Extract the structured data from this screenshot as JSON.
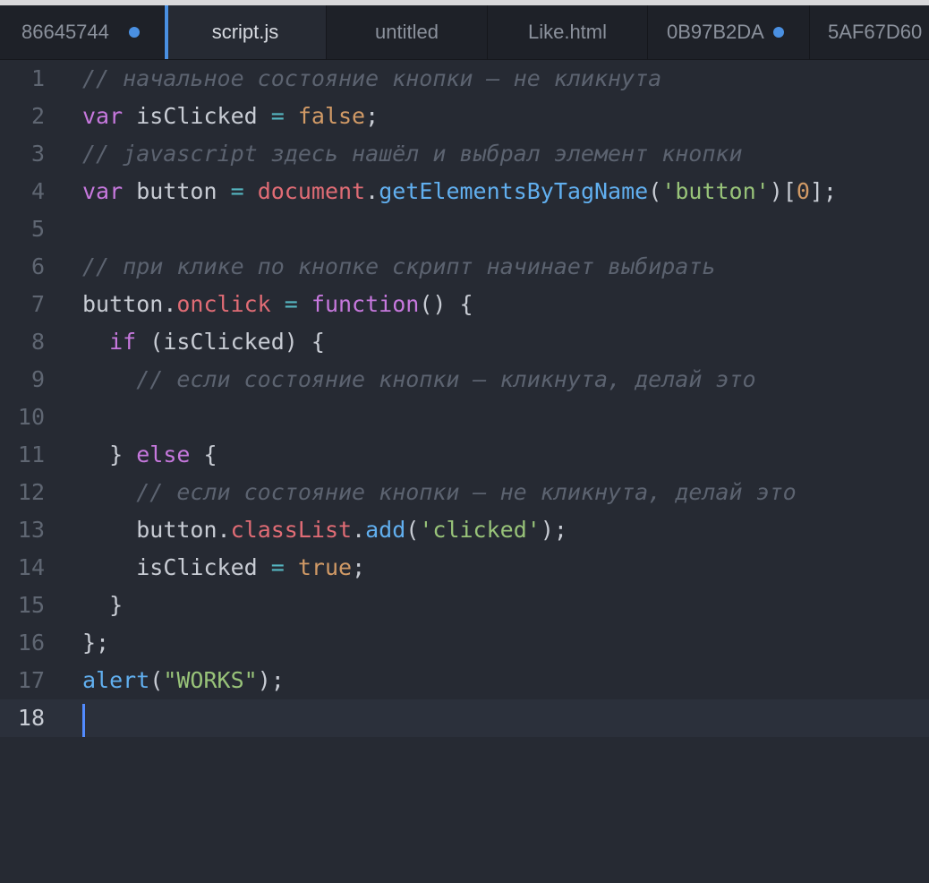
{
  "tabs": [
    {
      "label": "86645744",
      "modified": true
    },
    {
      "label": "script.js",
      "modified": false,
      "active": true
    },
    {
      "label": "untitled",
      "modified": false
    },
    {
      "label": "Like.html",
      "modified": false
    },
    {
      "label": "0B97B2DA",
      "modified": true
    },
    {
      "label": "5AF67D60",
      "modified": false
    }
  ],
  "editor": {
    "current_line": 18,
    "lines": [
      {
        "n": "1",
        "tokens": [
          [
            "cm",
            "// начальное состояние кнопки – не кликнута"
          ]
        ]
      },
      {
        "n": "2",
        "tokens": [
          [
            "kw",
            "var"
          ],
          [
            "vr",
            " isClicked "
          ],
          [
            "op",
            "="
          ],
          [
            "nb",
            " false"
          ],
          [
            "pu",
            ";"
          ]
        ]
      },
      {
        "n": "3",
        "tokens": [
          [
            "cm",
            "// javascript здесь нашёл и выбрал элемент кнопки"
          ]
        ]
      },
      {
        "n": "4",
        "tokens": [
          [
            "kw",
            "var"
          ],
          [
            "vr",
            " button "
          ],
          [
            "op",
            "="
          ],
          [
            "pu",
            " "
          ],
          [
            "pr",
            "document"
          ],
          [
            "pu",
            "."
          ],
          [
            "fn",
            "getElementsByTagName"
          ],
          [
            "pu",
            "("
          ],
          [
            "st",
            "'button'"
          ],
          [
            "pu",
            ")["
          ],
          [
            "nb",
            "0"
          ],
          [
            "pu",
            "];"
          ]
        ]
      },
      {
        "n": "5",
        "tokens": []
      },
      {
        "n": "6",
        "tokens": [
          [
            "cm",
            "// при клике по кнопке скрипт начинает выбирать"
          ]
        ]
      },
      {
        "n": "7",
        "tokens": [
          [
            "vr",
            "button"
          ],
          [
            "pu",
            "."
          ],
          [
            "pr",
            "onclick"
          ],
          [
            "op",
            " ="
          ],
          [
            "pu",
            " "
          ],
          [
            "kw",
            "function"
          ],
          [
            "pu",
            "() {"
          ]
        ]
      },
      {
        "n": "8",
        "tokens": [
          [
            "pu",
            "  "
          ],
          [
            "kw",
            "if"
          ],
          [
            "pu",
            " (isClicked) {"
          ]
        ]
      },
      {
        "n": "9",
        "tokens": [
          [
            "pu",
            "    "
          ],
          [
            "cm",
            "// если состояние кнопки – кликнута, делай это"
          ]
        ]
      },
      {
        "n": "10",
        "tokens": []
      },
      {
        "n": "11",
        "tokens": [
          [
            "pu",
            "  } "
          ],
          [
            "kw",
            "else"
          ],
          [
            "pu",
            " {"
          ]
        ]
      },
      {
        "n": "12",
        "tokens": [
          [
            "pu",
            "    "
          ],
          [
            "cm",
            "// если состояние кнопки – не кликнута, делай это"
          ]
        ]
      },
      {
        "n": "13",
        "tokens": [
          [
            "pu",
            "    "
          ],
          [
            "vr",
            "button"
          ],
          [
            "pu",
            "."
          ],
          [
            "pr",
            "classList"
          ],
          [
            "pu",
            "."
          ],
          [
            "fn",
            "add"
          ],
          [
            "pu",
            "("
          ],
          [
            "st",
            "'clicked'"
          ],
          [
            "pu",
            ");"
          ]
        ]
      },
      {
        "n": "14",
        "tokens": [
          [
            "pu",
            "    "
          ],
          [
            "vr",
            "isClicked "
          ],
          [
            "op",
            "="
          ],
          [
            "nb",
            " true"
          ],
          [
            "pu",
            ";"
          ]
        ]
      },
      {
        "n": "15",
        "tokens": [
          [
            "pu",
            "  }"
          ]
        ]
      },
      {
        "n": "16",
        "tokens": [
          [
            "pu",
            "};"
          ]
        ]
      },
      {
        "n": "17",
        "tokens": [
          [
            "fn",
            "alert"
          ],
          [
            "pu",
            "("
          ],
          [
            "st",
            "\"WORKS\""
          ],
          [
            "pu",
            ");"
          ]
        ]
      },
      {
        "n": "18",
        "tokens": []
      }
    ]
  },
  "colors": {
    "accent": "#4a90e2",
    "background": "#262a33",
    "tab_bar": "#1e2128"
  }
}
